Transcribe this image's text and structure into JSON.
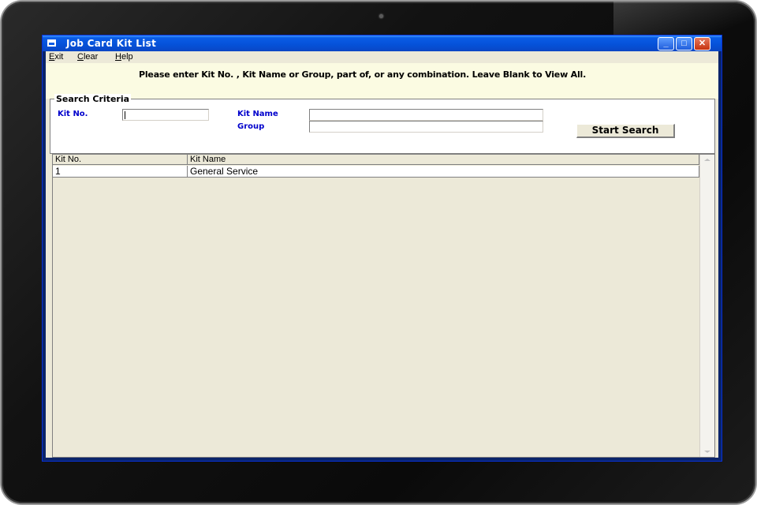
{
  "window": {
    "title": "Job Card Kit List",
    "minimize_glyph": "_",
    "maximize_glyph": "□",
    "close_glyph": "✕"
  },
  "menu": {
    "items": [
      {
        "label": "Exit",
        "mnemonic": "E"
      },
      {
        "label": "Clear",
        "mnemonic": "C"
      },
      {
        "label": "Help",
        "mnemonic": "H"
      }
    ]
  },
  "instruction": "Please enter Kit No. , Kit Name  or Group,  part of, or any combination. Leave Blank to View All.",
  "search": {
    "legend": "Search Criteria",
    "kit_no_label": "Kit No.",
    "kit_no_value": "",
    "kit_name_label": "Kit Name",
    "kit_name_value": "",
    "group_label": "Group",
    "group_value": "",
    "button_label": "Start Search"
  },
  "grid": {
    "columns": [
      "Kit No.",
      "Kit Name"
    ],
    "rows": [
      [
        "1",
        "General Service"
      ]
    ]
  }
}
